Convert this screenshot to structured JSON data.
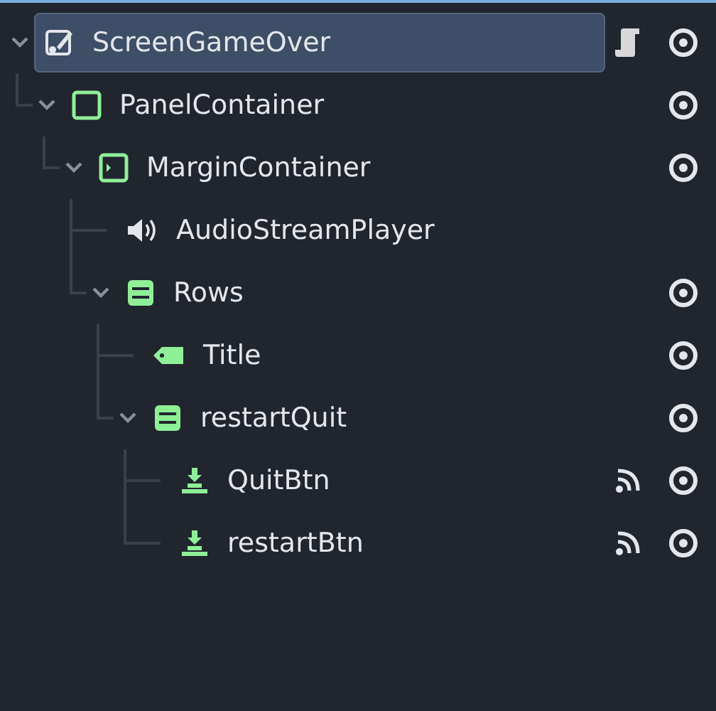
{
  "scene_tree": [
    {
      "name": "ScreenGameOver",
      "kind": "control",
      "selected": true,
      "expanded": true,
      "script": true,
      "visible": true,
      "children": [
        {
          "name": "PanelContainer",
          "kind": "panel",
          "selected": false,
          "expanded": true,
          "visible": true,
          "children": [
            {
              "name": "MarginContainer",
              "kind": "margin",
              "selected": false,
              "expanded": true,
              "visible": true,
              "children": [
                {
                  "name": "AudioStreamPlayer",
                  "kind": "audio",
                  "selected": false
                },
                {
                  "name": "Rows",
                  "kind": "vbox",
                  "selected": false,
                  "expanded": true,
                  "visible": true,
                  "children": [
                    {
                      "name": "Title",
                      "kind": "label",
                      "selected": false,
                      "visible": true
                    },
                    {
                      "name": "restartQuit",
                      "kind": "vbox",
                      "selected": false,
                      "expanded": true,
                      "visible": true,
                      "children": [
                        {
                          "name": "QuitBtn",
                          "kind": "button",
                          "selected": false,
                          "signals": true,
                          "visible": true
                        },
                        {
                          "name": "restartBtn",
                          "kind": "button",
                          "selected": false,
                          "signals": true,
                          "visible": true
                        }
                      ]
                    }
                  ]
                }
              ]
            }
          ]
        }
      ]
    }
  ]
}
